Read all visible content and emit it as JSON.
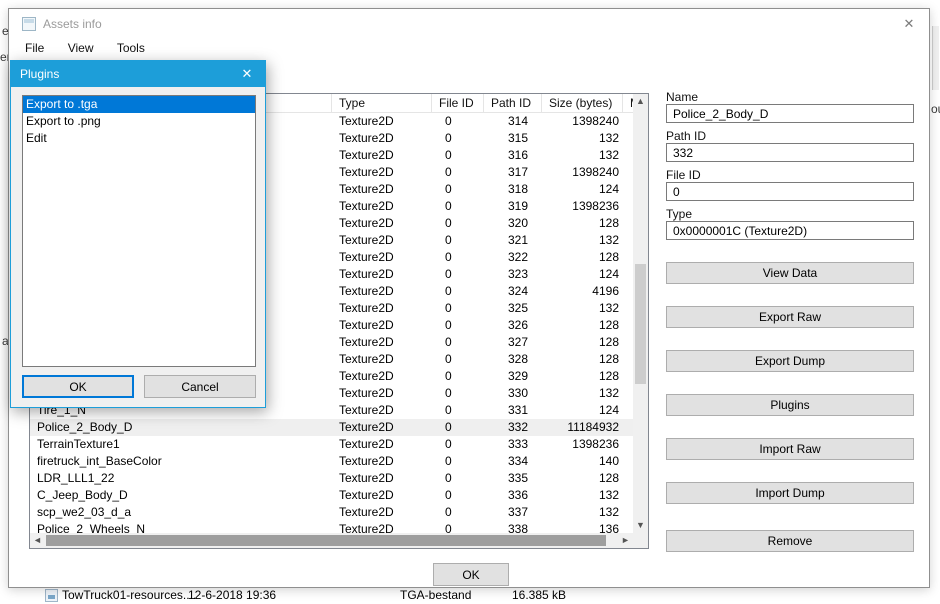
{
  "colors": {
    "dialog_titlebar": "#1d9ed9",
    "selection_blue": "#0078d7",
    "focus_border": "#0078d7"
  },
  "window": {
    "title": "Assets info",
    "close_glyph": "✕",
    "menu": [
      "File",
      "View",
      "Tools"
    ],
    "ok_label": "OK"
  },
  "table": {
    "columns": {
      "name": "",
      "type": "Type",
      "file_id": "File ID",
      "path_id": "Path ID",
      "size": "Size (bytes)",
      "modified": "M"
    },
    "selected_path_id": "332",
    "scroll_glyphs": {
      "up": "▲",
      "down": "▼",
      "left": "◄",
      "right": "►"
    },
    "rows": [
      {
        "name": "",
        "type": "Texture2D",
        "file_id": "0",
        "path_id": "314",
        "size": "1398240"
      },
      {
        "name": "",
        "type": "Texture2D",
        "file_id": "0",
        "path_id": "315",
        "size": "132"
      },
      {
        "name": "",
        "type": "Texture2D",
        "file_id": "0",
        "path_id": "316",
        "size": "132"
      },
      {
        "name": "",
        "type": "Texture2D",
        "file_id": "0",
        "path_id": "317",
        "size": "1398240"
      },
      {
        "name": "",
        "type": "Texture2D",
        "file_id": "0",
        "path_id": "318",
        "size": "124"
      },
      {
        "name": "",
        "type": "Texture2D",
        "file_id": "0",
        "path_id": "319",
        "size": "1398236"
      },
      {
        "name": "",
        "type": "Texture2D",
        "file_id": "0",
        "path_id": "320",
        "size": "128"
      },
      {
        "name": "",
        "type": "Texture2D",
        "file_id": "0",
        "path_id": "321",
        "size": "132"
      },
      {
        "name": "",
        "type": "Texture2D",
        "file_id": "0",
        "path_id": "322",
        "size": "128"
      },
      {
        "name": "",
        "type": "Texture2D",
        "file_id": "0",
        "path_id": "323",
        "size": "124"
      },
      {
        "name": "",
        "type": "Texture2D",
        "file_id": "0",
        "path_id": "324",
        "size": "4196"
      },
      {
        "name": "",
        "type": "Texture2D",
        "file_id": "0",
        "path_id": "325",
        "size": "132"
      },
      {
        "name": "",
        "type": "Texture2D",
        "file_id": "0",
        "path_id": "326",
        "size": "128"
      },
      {
        "name": "",
        "type": "Texture2D",
        "file_id": "0",
        "path_id": "327",
        "size": "128"
      },
      {
        "name": "",
        "type": "Texture2D",
        "file_id": "0",
        "path_id": "328",
        "size": "128"
      },
      {
        "name": "",
        "type": "Texture2D",
        "file_id": "0",
        "path_id": "329",
        "size": "128"
      },
      {
        "name": "",
        "type": "Texture2D",
        "file_id": "0",
        "path_id": "330",
        "size": "132"
      },
      {
        "name": "Tire_1_N",
        "type": "Texture2D",
        "file_id": "0",
        "path_id": "331",
        "size": "124"
      },
      {
        "name": "Police_2_Body_D",
        "type": "Texture2D",
        "file_id": "0",
        "path_id": "332",
        "size": "11184932"
      },
      {
        "name": "TerrainTexture1",
        "type": "Texture2D",
        "file_id": "0",
        "path_id": "333",
        "size": "1398236"
      },
      {
        "name": "firetruck_int_BaseColor",
        "type": "Texture2D",
        "file_id": "0",
        "path_id": "334",
        "size": "140"
      },
      {
        "name": "LDR_LLL1_22",
        "type": "Texture2D",
        "file_id": "0",
        "path_id": "335",
        "size": "128"
      },
      {
        "name": "C_Jeep_Body_D",
        "type": "Texture2D",
        "file_id": "0",
        "path_id": "336",
        "size": "132"
      },
      {
        "name": "scp_we2_03_d_a",
        "type": "Texture2D",
        "file_id": "0",
        "path_id": "337",
        "size": "132"
      },
      {
        "name": "Police_2_Wheels_N",
        "type": "Texture2D",
        "file_id": "0",
        "path_id": "338",
        "size": "136"
      }
    ]
  },
  "details": {
    "name_label": "Name",
    "name_value": "Police_2_Body_D",
    "path_id_label": "Path ID",
    "path_id_value": "332",
    "file_id_label": "File ID",
    "file_id_value": "0",
    "type_label": "Type",
    "type_value": "0x0000001C (Texture2D)",
    "buttons": [
      "View Data",
      "Export Raw",
      "Export Dump",
      "Plugins",
      "Import Raw",
      "Import Dump",
      "Remove"
    ]
  },
  "plugins_dialog": {
    "title": "Plugins",
    "close_glyph": "✕",
    "items": [
      "Export to .tga",
      "Export to .png",
      "Edit"
    ],
    "selected_index": 0,
    "ok_label": "OK",
    "cancel_label": "Cancel"
  },
  "background": {
    "file_row": {
      "name": "TowTruck01-resources....",
      "date": "12-6-2018 19:36",
      "type": "TGA-bestand",
      "size": "16.385 kB"
    },
    "fragments": [
      "e",
      "er",
      "a",
      "ou"
    ]
  }
}
